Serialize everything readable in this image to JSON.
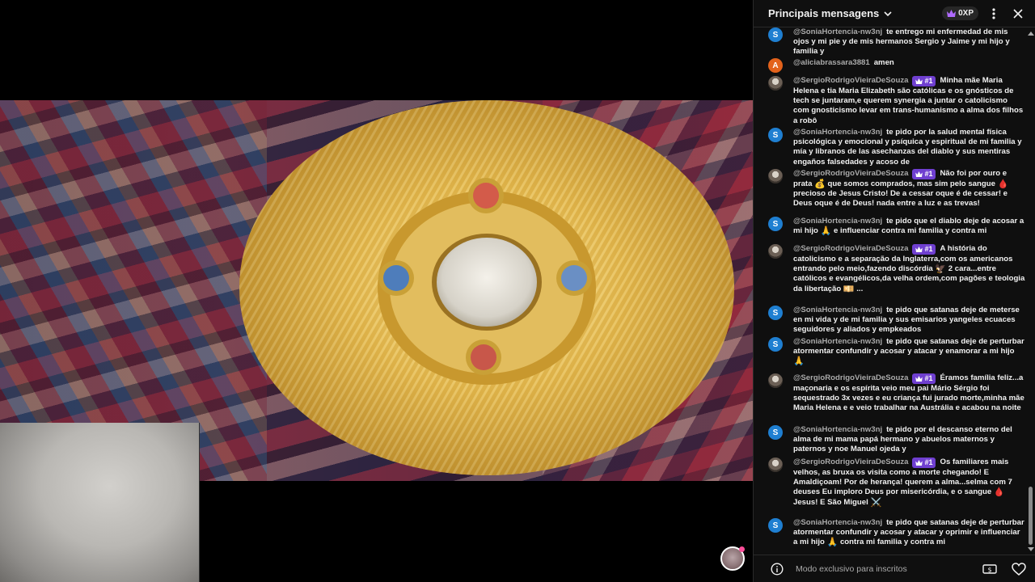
{
  "chat": {
    "header": {
      "title": "Principais mensagens",
      "xp": "0XP"
    },
    "footer": {
      "info": "Modo exclusivo para inscritos"
    },
    "messages": [
      {
        "author": "@SoniaHortencia-nw3nj",
        "avatar_letter": "S",
        "avatar_color": "#1f7fd1",
        "text": "te entrego mi enfermedad de mis ojos y mi pie y de mis hermanos Sergio y Jaime y mi hijo y familia y"
      },
      {
        "author": "@aliciabrassara3881",
        "avatar_letter": "A",
        "avatar_color": "#e3621b",
        "text": "amen"
      },
      {
        "author": "@SergioRodrigoVieiraDeSouza",
        "badge": "#1",
        "text": "Minha mãe Maria Helena e tia Maria Elizabeth são católicas e os gnósticos de tech se juntaram,e querem synergia a juntar o catolicismo com gnosticismo levar em trans-humanismo a alma dos filhos a robô"
      },
      {
        "author": "@SoniaHortencia-nw3nj",
        "avatar_letter": "S",
        "avatar_color": "#1f7fd1",
        "text": "te pido por la salud mental física psicológica y emocional y psíquica y espiritual de mi familia y mía y libranos de las asechanzas del diablo y sus mentiras engaños falsedades y acoso de"
      },
      {
        "author": "@SergioRodrigoVieiraDeSouza",
        "badge": "#1",
        "text_a": "Não foi por ouro e prata",
        "emoji_a": "💰",
        "text_b": "que somos comprados, mas sim pelo sangue",
        "emoji_b": "🩸",
        "text_c": "precioso de Jesus Cristo! De a cessar oque é de cessar! e Deus oque é de Deus! nada entre a luz e as trevas!"
      },
      {
        "author": "@SoniaHortencia-nw3nj",
        "avatar_letter": "S",
        "avatar_color": "#1f7fd1",
        "text_a": "te pido que el diablo deje de acosar a mi hijo",
        "emoji_a": "🙏",
        "text_b": "e influenciar contra mi familia y contra mi"
      },
      {
        "author": "@SergioRodrigoVieiraDeSouza",
        "badge": "#1",
        "text_a": "A história do catolicismo e a separação da Inglaterra,com os americanos entrando pelo meio,fazendo discórdia",
        "emoji_a": "🦅",
        "text_b": "2 cara...entre católicos e evangélicos,da velha ordem,com pagões e teologia da libertação",
        "emoji_b": "💴",
        "text_c": "..."
      },
      {
        "author": "@SoniaHortencia-nw3nj",
        "avatar_letter": "S",
        "avatar_color": "#1f7fd1",
        "text": "te pido que satanas deje de meterse en mi vida y de mi familia y sus emisarios yangeles ecuaces seguidores y aliados y empkeados"
      },
      {
        "author": "@SoniaHortencia-nw3nj",
        "avatar_letter": "S",
        "avatar_color": "#1f7fd1",
        "text_a": "te pido que satanas deje de perturbar atormentar confundir y acosar y atacar y enamorar a mi hijo",
        "emoji_a": "🙏"
      },
      {
        "author": "@SergioRodrigoVieiraDeSouza",
        "badge": "#1",
        "text": "Éramos família feliz...a maçonaria e os espírita veio meu pai Mário Sérgio foi sequestrado 3x vezes e eu criança fui jurado morte,minha mãe Maria Helena e e veio trabalhar na Austrália e acabou na noite"
      },
      {
        "author": "@SoniaHortencia-nw3nj",
        "avatar_letter": "S",
        "avatar_color": "#1f7fd1",
        "text": "te pido por el descanso eterno del alma de mi mama papá hermano y abuelos maternos y paternos y noe Manuel ojeda y"
      },
      {
        "author": "@SergioRodrigoVieiraDeSouza",
        "badge": "#1",
        "text_a": "Os familiares mais velhos, as bruxa os visita como a morte chegando! E Amaldiçoam! Por de herança! querem a alma...selma com 7 deuses Eu imploro Deus por misericórdia, e o sangue",
        "emoji_a": "🩸",
        "text_b": "Jesus! E São Miguel",
        "emoji_b": "⚔️"
      },
      {
        "author": "@SoniaHortencia-nw3nj",
        "avatar_letter": "S",
        "avatar_color": "#1f7fd1",
        "text_a": "te pido que satanas deje de perturbar atormentar confundir y acosar y atacar y oprimir e influenciar a mi hijo",
        "emoji_a": "🙏",
        "text_b": "contra mi familia y contra mi"
      }
    ]
  }
}
